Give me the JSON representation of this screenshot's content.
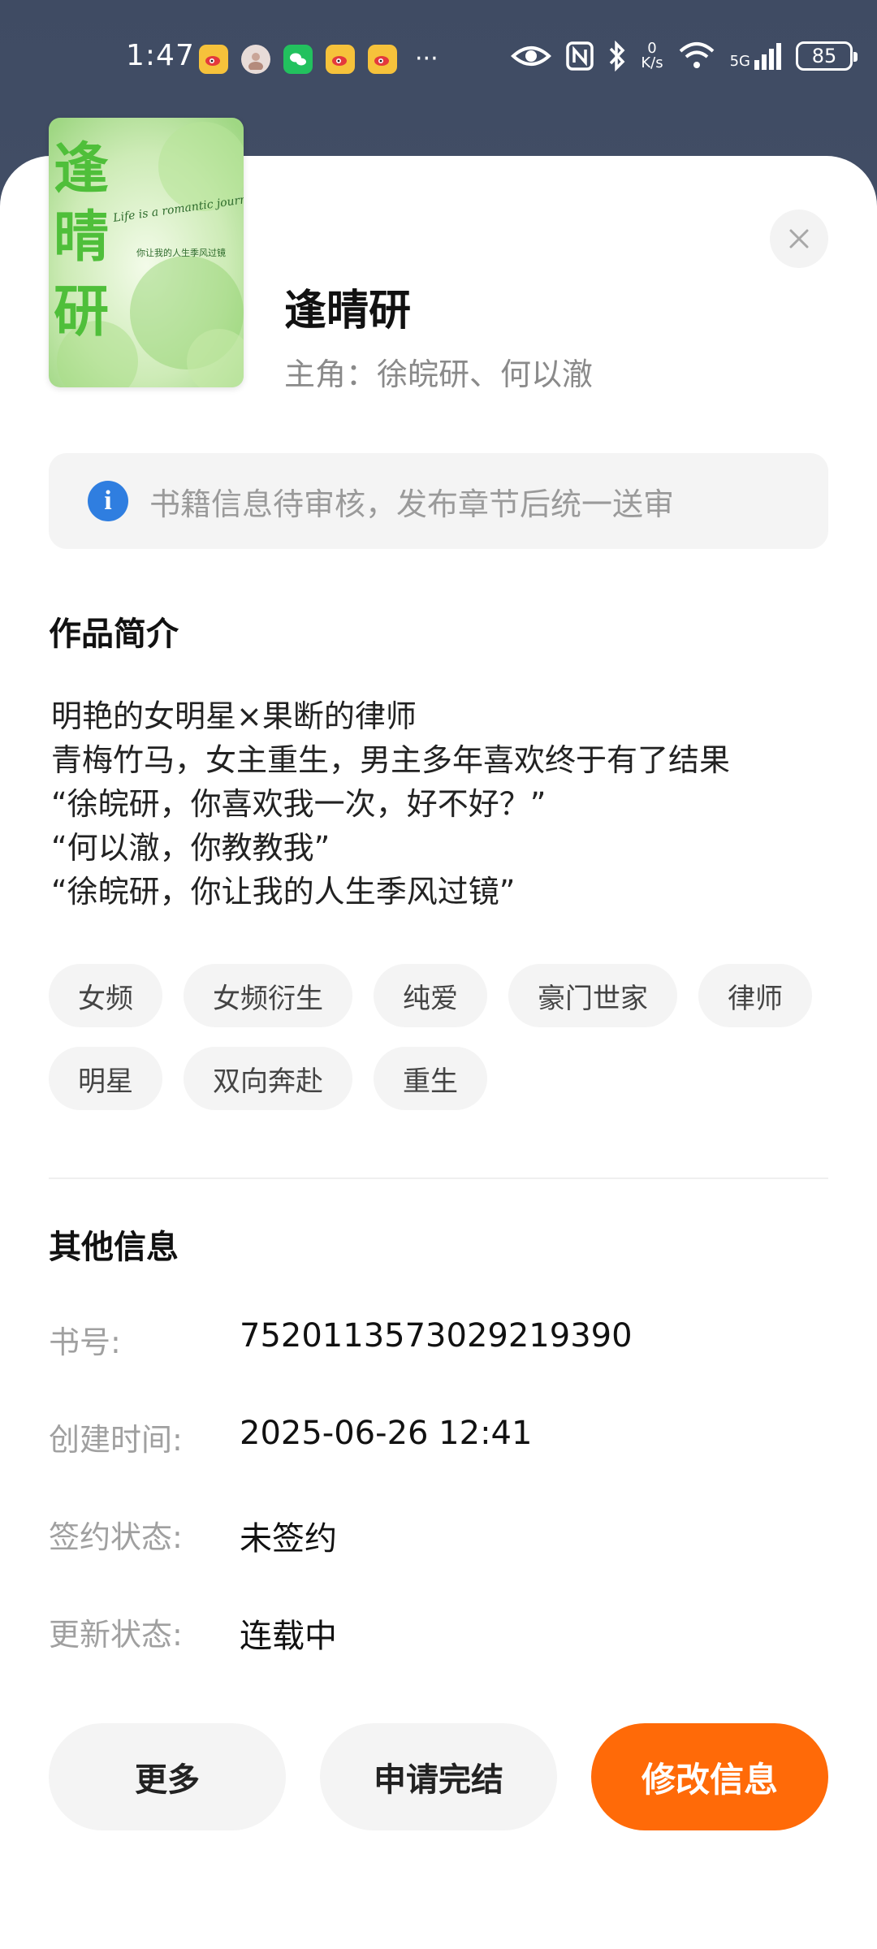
{
  "status_bar": {
    "time": "1:47",
    "notification_icons": [
      "weibo-icon",
      "avatar-icon",
      "wechat-icon",
      "weibo-icon",
      "weibo-icon"
    ],
    "more": "···",
    "net_speed_value": "0",
    "net_speed_unit": "K/s",
    "network": "5G",
    "battery": "85"
  },
  "book": {
    "cover_text": "逢晴研",
    "cover_subtitle": "Life is a romantic journey",
    "cover_small": "你让我的人生季风过镜",
    "title": "逢晴研",
    "protagonists": "主角：徐皖研、何以澈"
  },
  "notice": {
    "text": "书籍信息待审核，发布章节后统一送审"
  },
  "intro": {
    "section_title": "作品简介",
    "lines": [
      "明艳的女明星×果断的律师",
      "青梅竹马，女主重生，男主多年喜欢终于有了结果",
      "“徐皖研，你喜欢我一次，好不好？”",
      "“何以澈，你教教我”",
      "“徐皖研，你让我的人生季风过镜”"
    ]
  },
  "tags": [
    "女频",
    "女频衍生",
    "纯爱",
    "豪门世家",
    "律师",
    "明星",
    "双向奔赴",
    "重生"
  ],
  "other_info": {
    "section_title": "其他信息",
    "book_id_label": "书号:",
    "book_id": "7520113573029219390",
    "created_label": "创建时间:",
    "created": "2025-06-26 12:41",
    "sign_label": "签约状态:",
    "sign_status": "未签约",
    "update_label": "更新状态:",
    "update_status": "连载中"
  },
  "actions": {
    "more": "更多",
    "finish": "申请完结",
    "edit": "修改信息"
  },
  "colors": {
    "accent": "#ff6a08",
    "info_icon": "#2f7ee0",
    "cover_green": "#4fbf3a"
  }
}
